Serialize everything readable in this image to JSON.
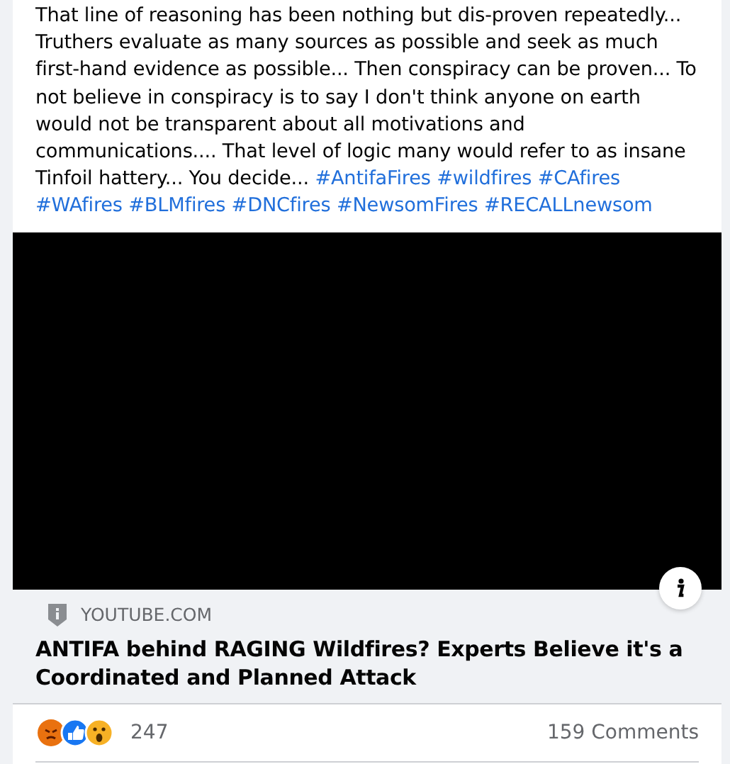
{
  "post": {
    "text": "That line of reasoning has been nothing but dis-proven repeatedly... Truthers evaluate as many sources as possible and seek as much first-hand evidence as possible... Then conspiracy can be proven... To not believe in conspiracy is to say I don't think anyone on earth would not be transparent about all motivations and communications.... That level of logic many would refer to as insane Tinfoil hattery... You decide...",
    "hashtags": [
      "#AntifaFires",
      "#wildfires",
      "#CAfires",
      "#WAfires",
      "#BLMfires",
      "#DNCfires",
      "#NewsomFires",
      "#RECALLnewsom"
    ]
  },
  "link": {
    "domain": "YOUTUBE.COM",
    "title": "ANTIFA behind RAGING Wildfires? Experts Believe it's a Coordinated and Planned Attack"
  },
  "reactions": {
    "count": "247",
    "comments": "159 Comments"
  }
}
